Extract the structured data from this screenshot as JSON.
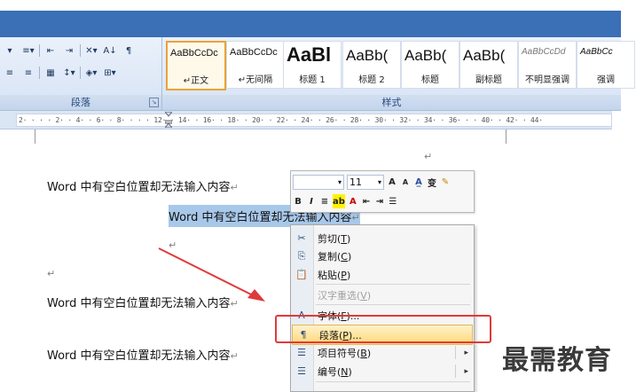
{
  "ribbon": {
    "paragraph_group_label": "段落",
    "styles_group_label": "样式",
    "paragraph_row1": [
      "▾",
      "≡▾",
      "⇤",
      "⇥",
      "✕▾",
      "A↓",
      "¶"
    ],
    "paragraph_row2": [
      "≡",
      "≡",
      "▦",
      "↕▾",
      "◈▾",
      "⊞▾"
    ],
    "style_tiles": [
      {
        "sample": "AaBbCcDc",
        "name": "↵正文",
        "active": true
      },
      {
        "sample": "AaBbCcDc",
        "name": "↵无间隔",
        "active": false
      },
      {
        "sample": "AaBl",
        "name": "标题 1",
        "active": false
      },
      {
        "sample": "AaBb(",
        "name": "标题 2",
        "active": false
      },
      {
        "sample": "AaBb(",
        "name": "标题",
        "active": false
      },
      {
        "sample": "AaBb(",
        "name": "副标题",
        "active": false
      },
      {
        "sample": "AaBbCcDd",
        "name": "不明显强调",
        "active": false
      },
      {
        "sample": "AaBbCc",
        "name": "强调",
        "active": false
      }
    ]
  },
  "ruler": {
    "text": "2· · · · 2· · 4· · 6· · 8· ·  · · 12· · 14· · 16· · 18· · 20· · 22· · 24· · 26· · 28· · 30· · 32· · 34· · 36·   · · 40· · 42· · 44·"
  },
  "document": {
    "line1": "Word 中有空白位置却无法输入内容",
    "selected_line": "Word 中有空白位置却无法输入内容",
    "line3": "Word 中有空白位置却无法输入内容",
    "line4": "Word 中有空白位置却无法输入内容",
    "para_mark": "↵",
    "empty_mark": "↵"
  },
  "mini_toolbar": {
    "font_name": "",
    "font_size": "11",
    "row1_buttons": [
      "A",
      "A",
      "A̲",
      "变",
      "✎"
    ],
    "row2_buttons": [
      "B",
      "I",
      "≡",
      "ab",
      "A",
      "⇤",
      "⇥",
      "☰"
    ]
  },
  "context_menu": {
    "items": [
      {
        "icon": "✂",
        "label": "剪切",
        "key": "T",
        "disabled": false
      },
      {
        "icon": "⎘",
        "label": "复制",
        "key": "C",
        "disabled": false
      },
      {
        "icon": "📋",
        "label": "粘贴",
        "key": "P",
        "disabled": false
      },
      {
        "icon": "",
        "label": "汉字重选",
        "key": "V",
        "disabled": true
      },
      {
        "icon": "A",
        "label": "字体",
        "key": "F",
        "suffix": "...",
        "disabled": false
      },
      {
        "icon": "¶",
        "label": "段落",
        "key": "P",
        "suffix": "...",
        "disabled": false,
        "hover": true
      },
      {
        "icon": "☰",
        "label": "项目符号",
        "key": "B",
        "disabled": false,
        "submenu": true
      },
      {
        "icon": "☰",
        "label": "编号",
        "key": "N",
        "disabled": false,
        "submenu": true
      }
    ]
  },
  "watermark": "最需教育",
  "colors": {
    "highlight_box": "#e03a3a",
    "arrow": "#e03a3a",
    "selection": "#a8c8ea",
    "hover": "#ffd87a"
  }
}
